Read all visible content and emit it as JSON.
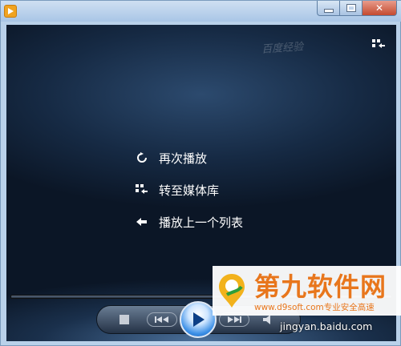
{
  "window": {
    "app_icon": "media-player-icon",
    "minimize_icon": "minimize-icon",
    "maximize_icon": "maximize-icon",
    "close_icon": "close-icon",
    "close_symbol": "✕"
  },
  "video": {
    "watermark_text": "百度经验",
    "corner_icon": "switch-to-library-icon"
  },
  "menu": {
    "items": [
      {
        "label": "再次播放",
        "icon": "replay-icon"
      },
      {
        "label": "转至媒体库",
        "icon": "library-icon"
      },
      {
        "label": "播放上一个列表",
        "icon": "back-arrow-icon"
      }
    ]
  },
  "controls": {
    "stop_icon": "stop-icon",
    "prev_icon": "previous-track-icon",
    "play_icon": "play-icon",
    "next_icon": "next-track-icon",
    "volume_icon": "volume-icon"
  },
  "overlay": {
    "brand_title": "第九软件网",
    "brand_subtitle": "www.d9soft.com专业安全高速",
    "baidu_text": "jingyan.baidu.com"
  },
  "colors": {
    "brand_orange": "#e8761c",
    "play_blue": "#3b8fe6",
    "video_bg": "#0b1626"
  }
}
